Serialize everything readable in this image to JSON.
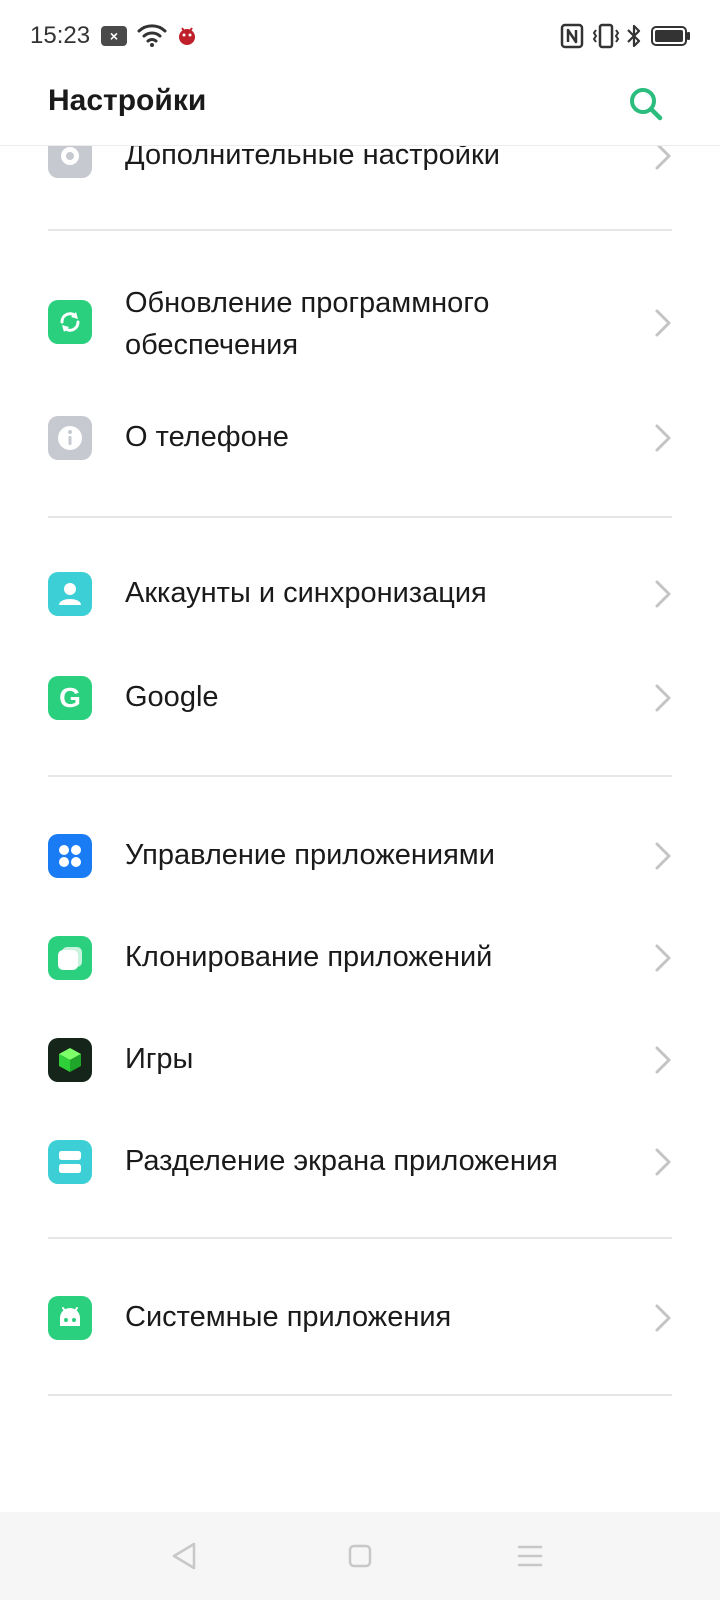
{
  "status_bar": {
    "time": "15:23",
    "notif_badge": "×",
    "icons": [
      "notification-icon",
      "wifi-icon",
      "bug-icon",
      "nfc-icon",
      "vibrate-icon",
      "bluetooth-icon",
      "battery-icon"
    ]
  },
  "header": {
    "title": "Настройки",
    "search_icon": "search-icon"
  },
  "colors": {
    "accent": "#2bbd7e",
    "gray_icon": "#c6c9cf",
    "teal_icon": "#3ccfcc",
    "blue_icon": "#1a7cf5",
    "dark_icon": "#1c2a1c",
    "divider": "#e6e6e6",
    "chevron": "#c4c4c4"
  },
  "settings": {
    "advanced": {
      "label": "Дополнительные настройки",
      "icon": "gear-icon"
    },
    "software_update": {
      "label_line1": "Обновление программного",
      "label_line2": "обеспечения",
      "icon": "update-icon"
    },
    "about_phone": {
      "label": "О телефоне",
      "icon": "info-icon"
    },
    "accounts": {
      "label": "Аккаунты и синхронизация",
      "icon": "person-icon"
    },
    "google": {
      "label": "Google",
      "icon": "google-icon",
      "glyph": "G"
    },
    "app_management": {
      "label": "Управление приложениями",
      "icon": "apps-grid-icon"
    },
    "app_cloner": {
      "label": "Клонирование приложений",
      "icon": "clone-icon"
    },
    "games": {
      "label": "Игры",
      "icon": "cube-icon"
    },
    "split_screen": {
      "label": "Разделение экрана приложения",
      "icon": "split-screen-icon"
    },
    "system_apps": {
      "label": "Системные приложения",
      "icon": "android-icon"
    }
  },
  "nav_bar": {
    "icons": [
      "back-icon",
      "home-icon",
      "recents-menu-icon"
    ]
  }
}
